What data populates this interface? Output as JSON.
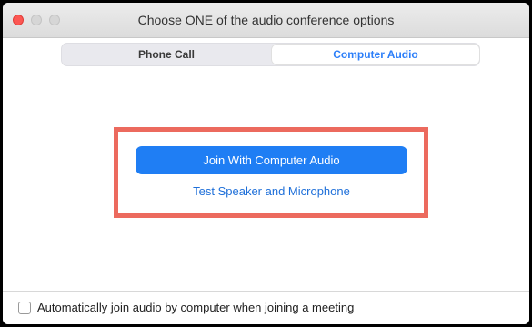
{
  "window": {
    "title": "Choose ONE of the audio conference options"
  },
  "tabs": [
    {
      "label": "Phone Call",
      "selected": false
    },
    {
      "label": "Computer Audio",
      "selected": true
    }
  ],
  "main": {
    "join_button_label": "Join With Computer Audio",
    "test_link_label": "Test Speaker and Microphone"
  },
  "footer": {
    "auto_join_label": "Automatically join audio by computer when joining a meeting",
    "auto_join_checked": false
  },
  "colors": {
    "accent": "#1f7ef4",
    "selected_tab_text": "#2d7ff9",
    "highlight_border": "#ec6a5e",
    "close_button": "#fc5753"
  }
}
